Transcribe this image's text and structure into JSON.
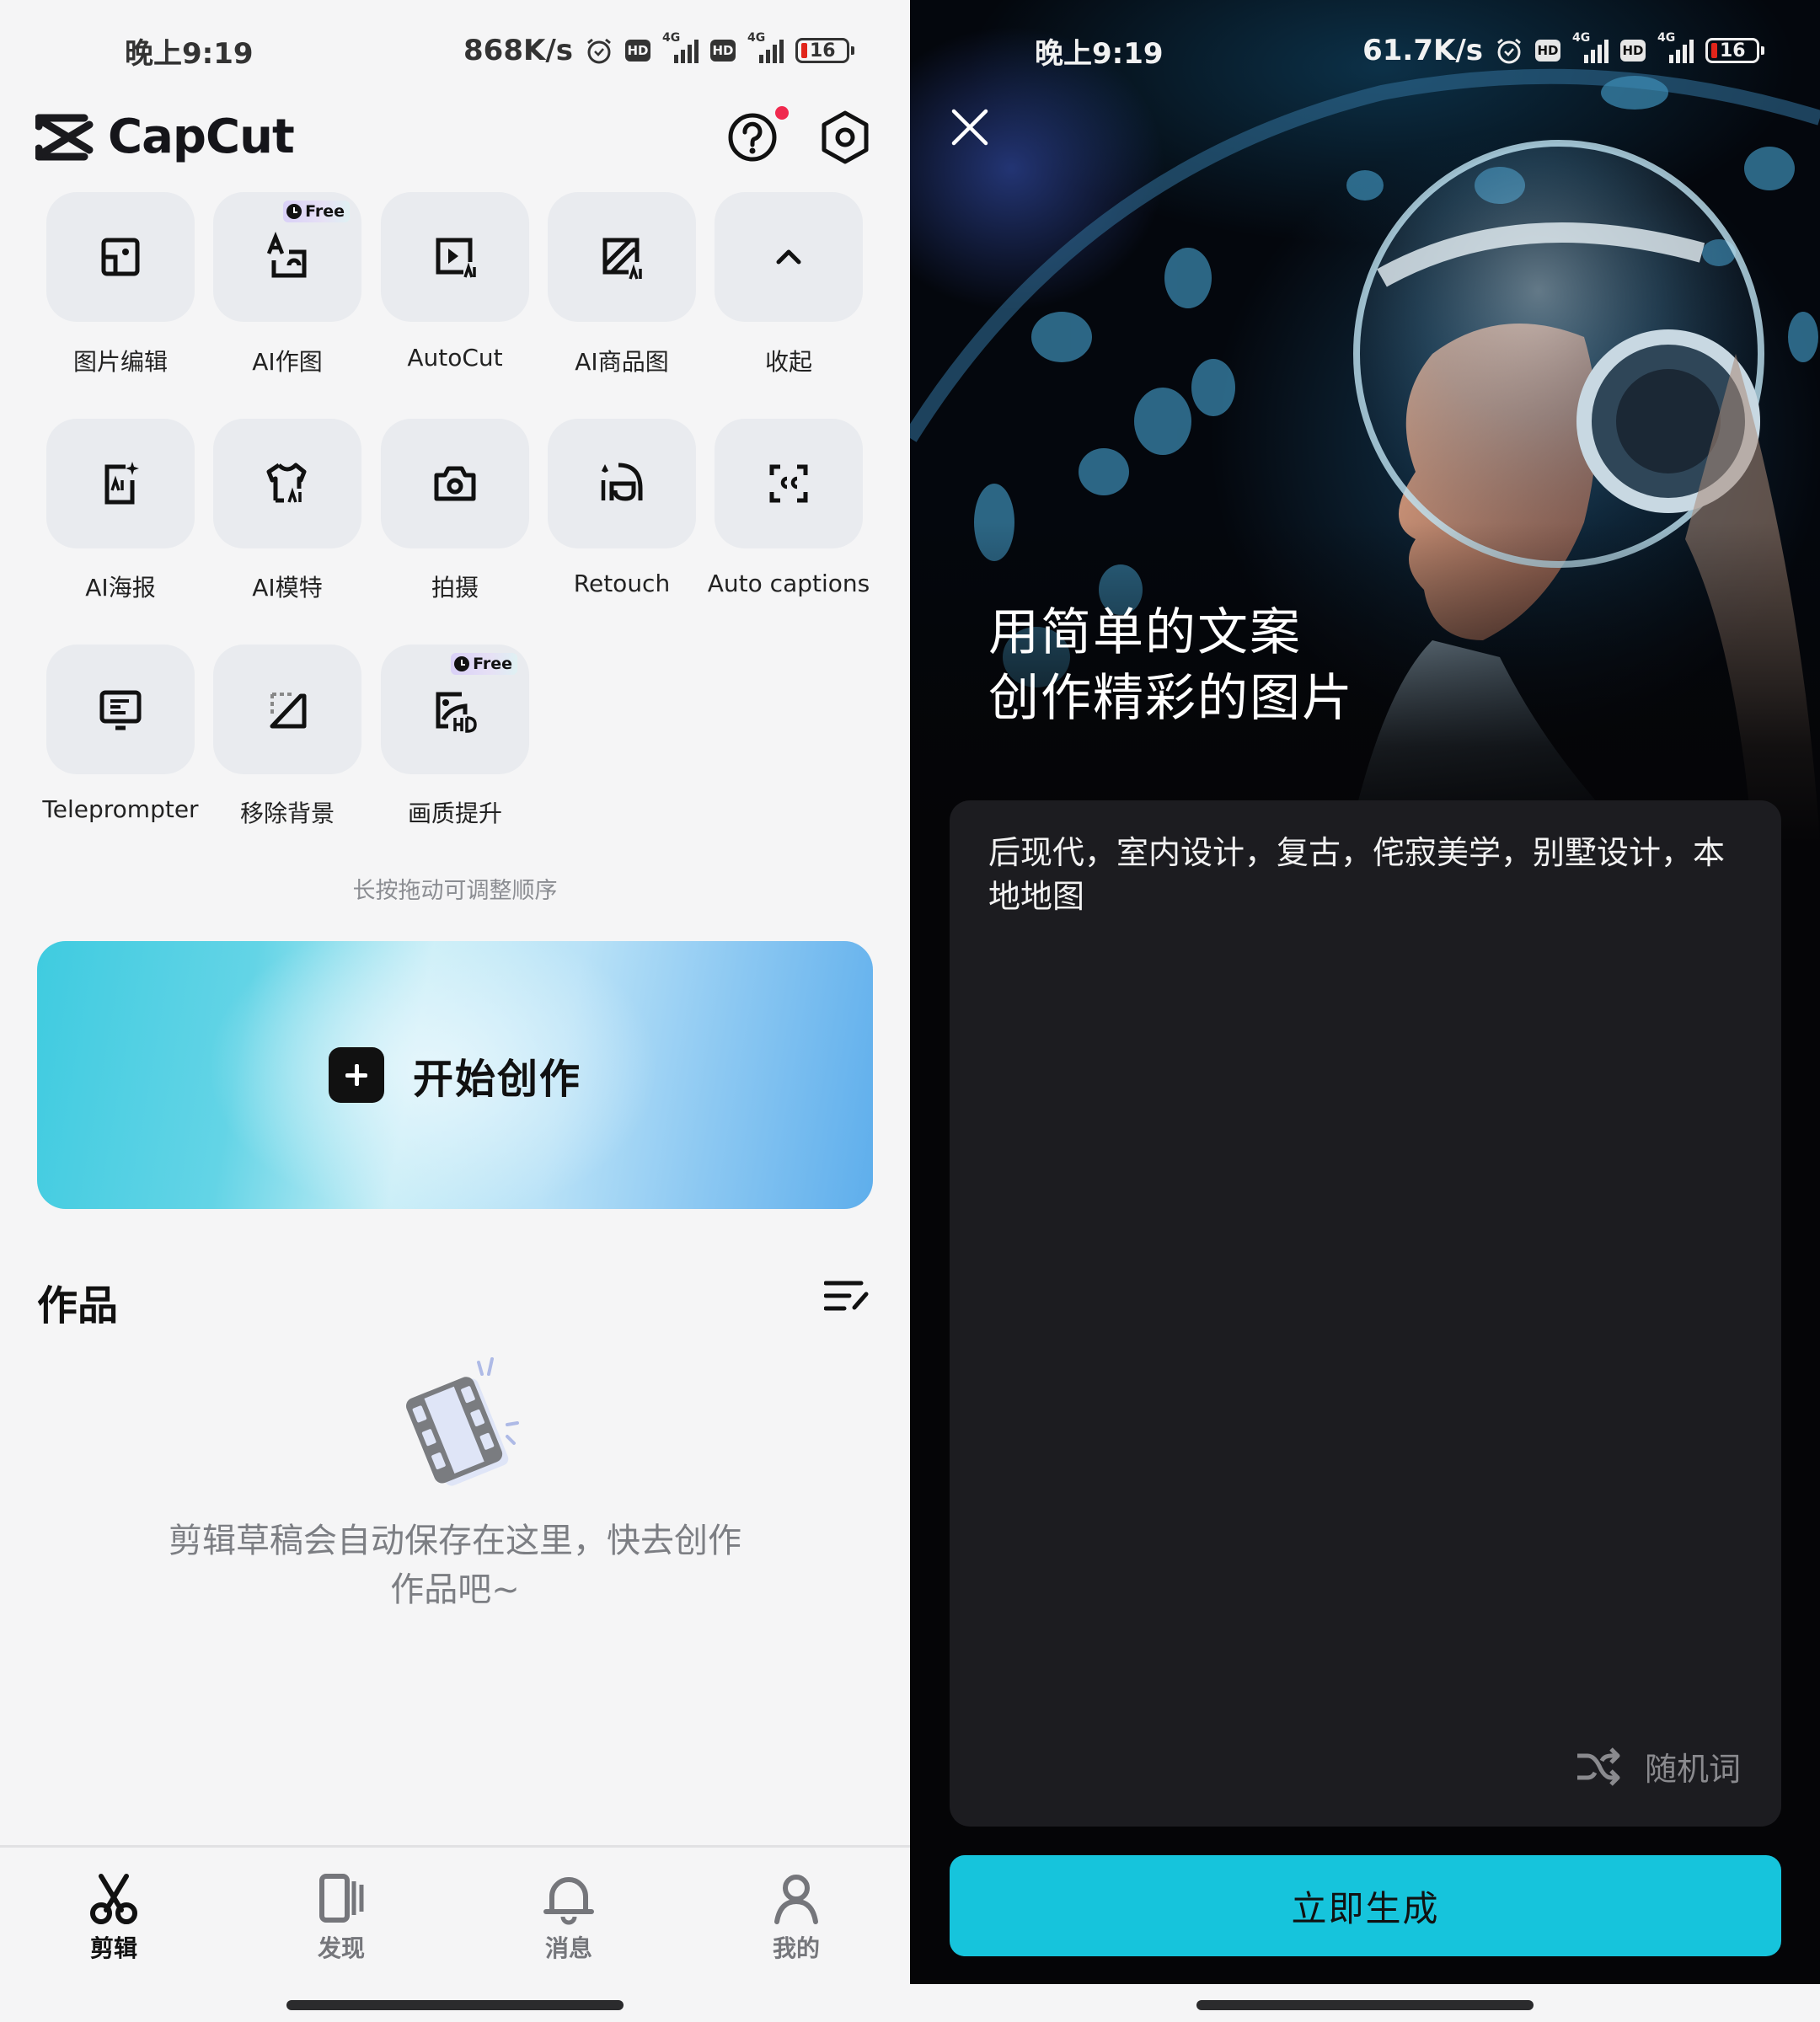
{
  "left": {
    "status_bar": {
      "time": "晚上9:19",
      "net_speed": "868K/s",
      "battery": "16",
      "network_1": "4G",
      "network_2": "4G",
      "hd_1": "HD",
      "hd_2": "HD"
    },
    "app": {
      "name": "CapCut",
      "help_has_notification": true
    },
    "tools": [
      {
        "label": "图片编辑",
        "icon": "photo-edit-icon",
        "free": false
      },
      {
        "label": "AI作图",
        "icon": "ai-draw-icon",
        "free": true
      },
      {
        "label": "AutoCut",
        "icon": "autocut-icon",
        "free": false
      },
      {
        "label": "AI商品图",
        "icon": "ai-product-icon",
        "free": false
      },
      {
        "label": "收起",
        "icon": "chevron-up-icon",
        "free": false
      },
      {
        "label": "AI海报",
        "icon": "ai-poster-icon",
        "free": false
      },
      {
        "label": "AI模特",
        "icon": "ai-model-icon",
        "free": false
      },
      {
        "label": "拍摄",
        "icon": "camera-icon",
        "free": false
      },
      {
        "label": "Retouch",
        "icon": "retouch-icon",
        "free": false
      },
      {
        "label": "Auto captions",
        "icon": "captions-icon",
        "free": false
      },
      {
        "label": "Teleprompter",
        "icon": "teleprompter-icon",
        "free": false
      },
      {
        "label": "移除背景",
        "icon": "remove-bg-icon",
        "free": false
      },
      {
        "label": "画质提升",
        "icon": "hd-upscale-icon",
        "free": true
      }
    ],
    "free_badge_label": "Free",
    "reorder_hint": "长按拖动可调整顺序",
    "create_button_label": "开始创作",
    "works": {
      "title": "作品",
      "empty_line_1": "剪辑草稿会自动保存在这里，快去创作",
      "empty_line_2": "作品吧~"
    },
    "tabbar": [
      {
        "label": "剪辑",
        "icon": "scissors-icon",
        "active": true
      },
      {
        "label": "发现",
        "icon": "discover-icon",
        "active": false
      },
      {
        "label": "消息",
        "icon": "bell-icon",
        "active": false
      },
      {
        "label": "我的",
        "icon": "profile-icon",
        "active": false
      }
    ]
  },
  "right": {
    "status_bar": {
      "time": "晚上9:19",
      "net_speed": "61.7K/s",
      "battery": "16",
      "network_1": "4G",
      "network_2": "4G",
      "hd_1": "HD",
      "hd_2": "HD"
    },
    "hero_title_line_1": "用简单的文案",
    "hero_title_line_2": "创作精彩的图片",
    "prompt_text": "后现代，室内设计，复古，侘寂美学，别墅设计，本地地图",
    "random_label": "随机词",
    "generate_label": "立即生成",
    "colors": {
      "accent": "#16c4dc",
      "panel": "#1c1c20",
      "background": "#050507"
    }
  }
}
